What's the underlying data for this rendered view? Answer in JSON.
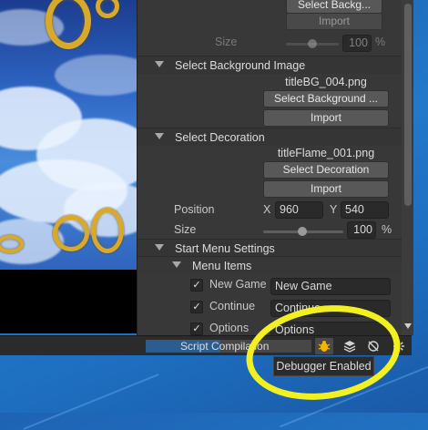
{
  "inspector": {
    "top_partial": {
      "button_partial": "Select Backg...",
      "import_label": "Import",
      "size_label": "Size",
      "size_value": "100",
      "size_unit": "%",
      "slider_fraction": 0.5
    },
    "background_section": {
      "header": "Select Background Image",
      "file_name": "titleBG_004.png",
      "select_button": "Select Background ...",
      "import_button": "Import"
    },
    "decoration_section": {
      "header": "Select Decoration",
      "file_name": "titleFlame_001.png",
      "select_button": "Select Decoration",
      "import_button": "Import",
      "position_label": "Position",
      "x_label": "X",
      "x_value": "960",
      "y_label": "Y",
      "y_value": "540",
      "size_label": "Size",
      "size_value": "100",
      "size_unit": "%",
      "slider_fraction": 0.5
    },
    "start_menu": {
      "header": "Start Menu Settings",
      "menu_items_header": "Menu Items",
      "items": [
        {
          "label": "New Game",
          "value": "New Game",
          "checked": true
        },
        {
          "label": "Continue",
          "value": "Continue",
          "checked": true
        },
        {
          "label": "Options",
          "value": "Options",
          "checked": true
        }
      ]
    }
  },
  "status_bar": {
    "progress_label": "Script Compilation",
    "progress": 0.45,
    "icons": [
      "debugger-bug-icon",
      "layers-icon",
      "no-network-icon",
      "loading-spinner-icon"
    ]
  },
  "tooltip": {
    "text": "Debugger Enabled"
  },
  "colors": {
    "accent_yellow": "#f2f021",
    "inspector_bg": "#383838",
    "progress_fill": "#2c5d8f"
  }
}
